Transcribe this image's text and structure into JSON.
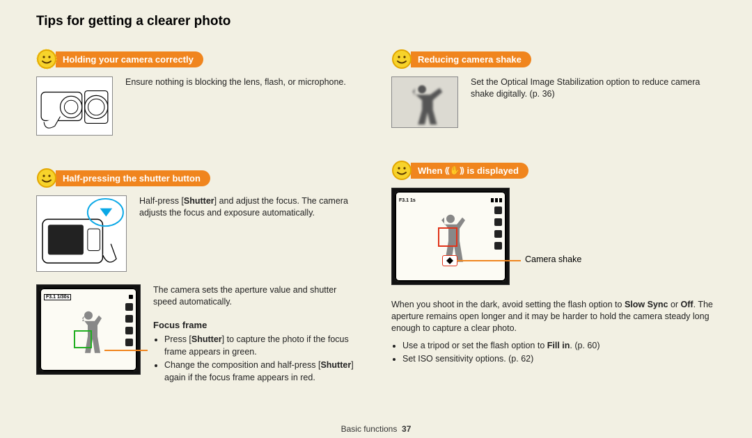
{
  "page": {
    "title": "Tips for getting a clearer photo",
    "footer_section": "Basic functions",
    "footer_page": "37"
  },
  "left": {
    "section1": {
      "heading": "Holding your camera correctly",
      "text": "Ensure nothing is blocking the lens, flash, or microphone."
    },
    "section2": {
      "heading": "Half-pressing the shutter button",
      "text_pre": "Half-press [",
      "shutter": "Shutter",
      "text_post": "] and adjust the focus. The camera adjusts the focus and exposure automatically.",
      "aperture_text": "The camera sets the aperture value and shutter speed automatically.",
      "focus_frame_label": "Focus frame",
      "focus_li1_pre": "Press [",
      "focus_li1_post": "] to capture the photo if the focus frame appears in green.",
      "focus_li2_pre": "Change the composition and half-press [",
      "focus_li2_post": "] again if the focus frame appears in red.",
      "lcd_top": "F3.1  1/30s"
    }
  },
  "right": {
    "section1": {
      "heading": "Reducing camera shake",
      "text": "Set the Optical Image Stabilization option to reduce camera shake digitally. (p. 36)"
    },
    "section2": {
      "heading_pre": "When ",
      "heading_post": " is displayed",
      "lcd_top": "F3.1  1s",
      "callout": "Camera shake",
      "para_pre": "When you shoot in the dark, avoid setting the flash option to ",
      "slow_sync": "Slow Sync",
      "or": " or ",
      "off": "Off",
      "para_post": ". The aperture remains open longer and it may be harder to hold the camera steady long enough to capture a clear photo.",
      "bullet1_pre": "Use a tripod or set the flash option to ",
      "fill_in": "Fill in",
      "bullet1_post": ". (p. 60)",
      "bullet2": "Set ISO sensitivity options. (p. 62)"
    }
  }
}
